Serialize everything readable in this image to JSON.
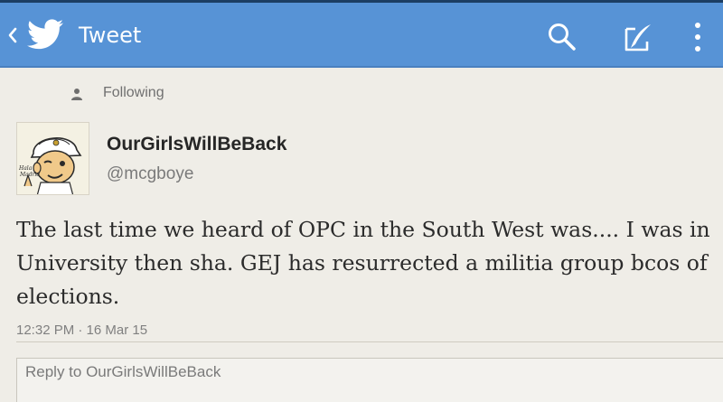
{
  "app_bar": {
    "title": "Tweet",
    "icons": [
      "back-chevron-icon",
      "twitter-bird-icon",
      "search-icon",
      "compose-icon",
      "overflow-menu-icon"
    ],
    "color": "#5793d6"
  },
  "follow_status": {
    "label": "Following",
    "icon": "person-icon"
  },
  "tweet": {
    "display_name": "OurGirlsWillBeBack",
    "handle": "@mcgboye",
    "avatar_text": [
      "Hala",
      "Madrid"
    ],
    "text": "The last time we heard of OPC in the South West was.... I was in University then sha. GEJ has resurrected a militia group bcos of elections.",
    "timestamp": "12:32 PM · 16 Mar 15"
  },
  "reply": {
    "placeholder": "Reply to OurGirlsWillBeBack"
  }
}
